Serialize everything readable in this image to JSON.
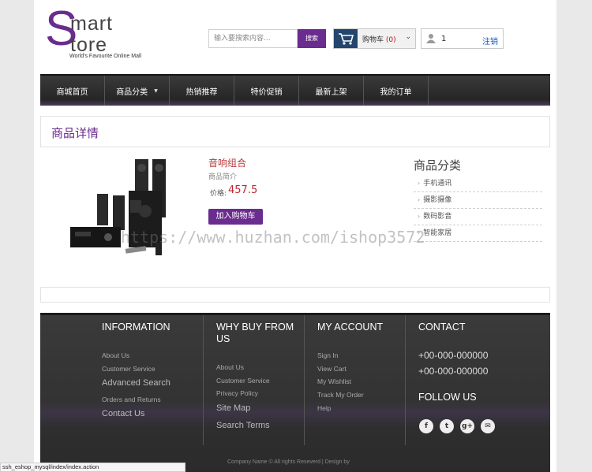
{
  "logo": {
    "letter": "S",
    "line1": "mart",
    "line2": "tore",
    "tagline": "World's Favourite Online Mall"
  },
  "header": {
    "search_placeholder": "输入要搜索内容...",
    "search_button": "搜索",
    "cart_label": "购物车",
    "cart_count": "(0)",
    "user_name": "1",
    "logout": "注销"
  },
  "nav": {
    "items": [
      {
        "label": "商城首页"
      },
      {
        "label": "商品分类"
      },
      {
        "label": "热销推荐"
      },
      {
        "label": "特价促销"
      },
      {
        "label": "最新上架"
      },
      {
        "label": "我的订单"
      }
    ]
  },
  "detail": {
    "section_title": "商品详情",
    "product_name": "音响组合",
    "product_desc": "商品简介",
    "price_label": "价格:",
    "price": "457.5",
    "add_to_cart": "加入购物车"
  },
  "categories": {
    "title": "商品分类",
    "items": [
      "手机通讯",
      "摄影摄像",
      "数码影音",
      "智能家居"
    ]
  },
  "watermark": "https://www.huzhan.com/ishop3572",
  "footer": {
    "col1": {
      "title": "INFORMATION",
      "links": [
        "About Us",
        "Customer Service",
        "Advanced Search",
        "Orders and Returns",
        "Contact Us"
      ]
    },
    "col2": {
      "title": "WHY BUY FROM US",
      "links": [
        "About Us",
        "Customer Service",
        "Privacy Policy",
        "Site Map",
        "Search Terms"
      ]
    },
    "col3": {
      "title": "MY ACCOUNT",
      "links": [
        "Sign In",
        "View Cart",
        "My Wishlist",
        "Track My Order",
        "Help"
      ]
    },
    "col4": {
      "title": "CONTACT",
      "phones": [
        "+00-000-000000",
        "+00-000-000000"
      ],
      "follow_title": "FOLLOW US",
      "social": [
        "f",
        "t",
        "g+",
        "✉"
      ]
    },
    "copyright": "Company Name © All rights Reseverd | Design by"
  },
  "status_url": "ssh_eshop_mysql/index/index.action"
}
